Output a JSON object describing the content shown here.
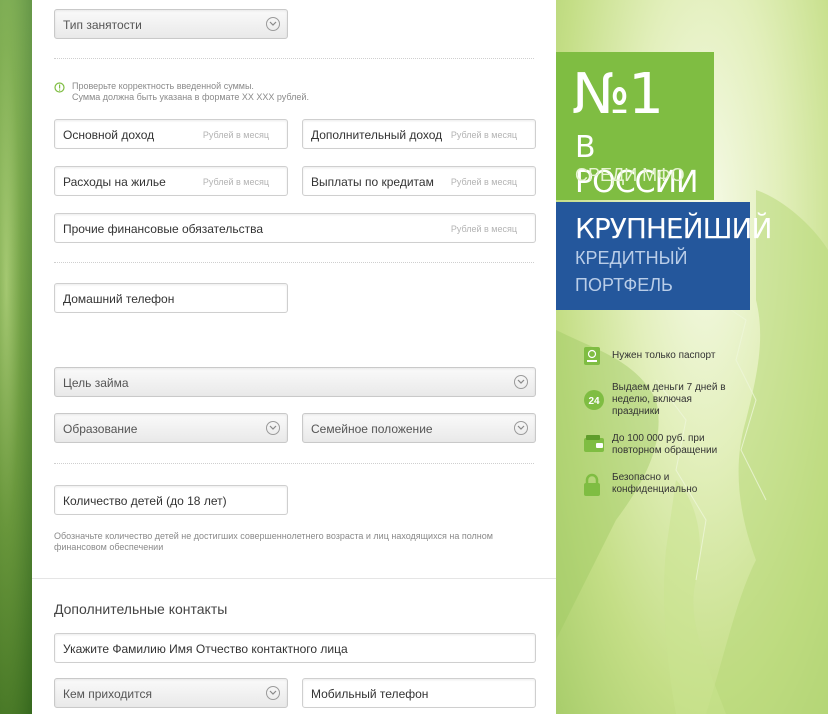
{
  "form": {
    "employment_type": "Тип занятости",
    "check_note_1": "Проверьте корректность введенной суммы.",
    "check_note_2": "Сумма должна быть указана в формате XX XXX рублей.",
    "main_income": "Основной доход",
    "extra_income": "Дополнительный доход",
    "housing": "Расходы на жилье",
    "credits": "Выплаты по кредитам",
    "other": "Прочие финансовые обязательства",
    "rub_hint": "Рублей в месяц",
    "home_phone": "Домашний телефон",
    "loan_purpose": "Цель займа",
    "education": "Образование",
    "marital": "Семейное положение",
    "children": "Количество детей (до 18 лет)",
    "children_note_1": "Обозначьте количество детей не достигших совершеннолетнего возраста и лиц находящихся на полном",
    "children_note_2": "финансовом обеспечении",
    "extra_contacts": "Дополнительные контакты",
    "contact_name": "Укажите Фамилию Имя Отчество контактного лица",
    "relation": "Кем приходится",
    "mobile": "Мобильный телефон"
  },
  "promo": {
    "no1": "№1",
    "russia": "В РОССИИ",
    "mfo": "СРЕДИ МФО",
    "biggest": "КРУПНЕЙШИЙ",
    "portfolio_1": "КРЕДИТНЫЙ",
    "portfolio_2": "ПОРТФЕЛЬ",
    "feature_1": "Нужен только паспорт",
    "feature_2_1": "Выдаем деньги 7 дней в",
    "feature_2_2": "неделю, включая",
    "feature_2_3": "праздники",
    "feature_3_1": "До 100 000 руб. при",
    "feature_3_2": "повторном обращении",
    "feature_4_1": "Безопасно и",
    "feature_4_2": "конфиденциально",
    "badge_24": "24"
  },
  "colors": {
    "green": "#7fbd42",
    "blue": "#24579c"
  }
}
